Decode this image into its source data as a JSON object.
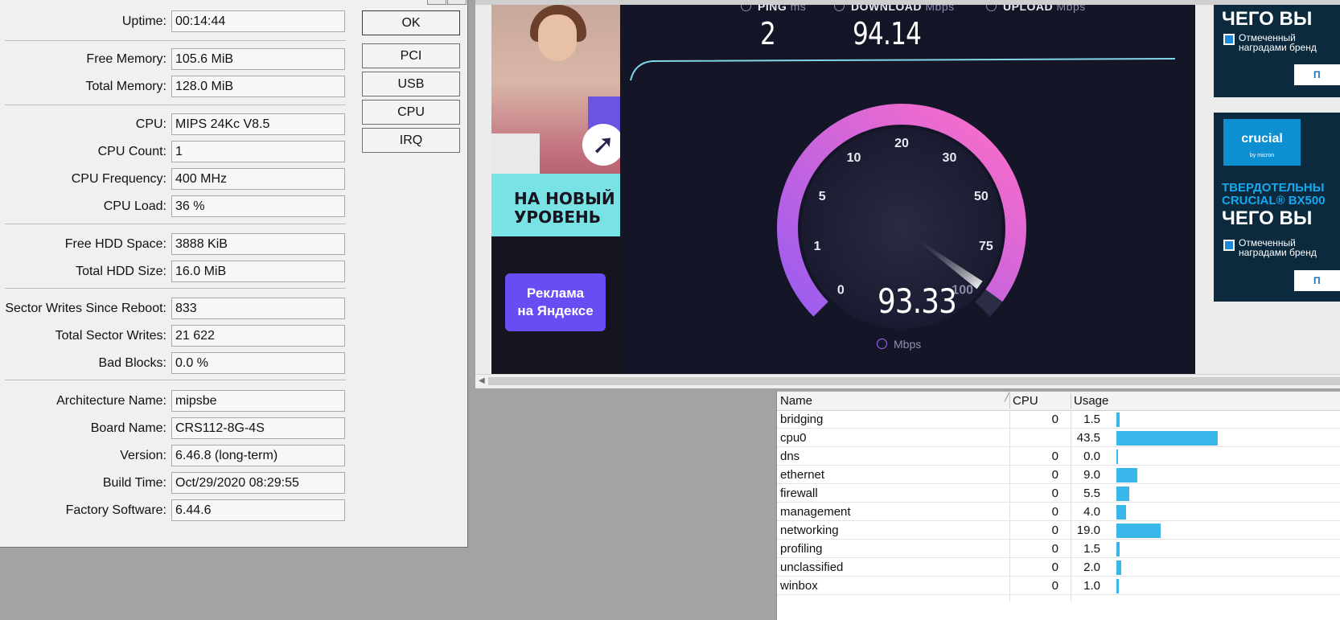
{
  "resources": {
    "rows": [
      {
        "label": "Uptime:",
        "value": "00:14:44"
      },
      {
        "label": "Free Memory:",
        "value": "105.6 MiB"
      },
      {
        "label": "Total Memory:",
        "value": "128.0 MiB"
      },
      {
        "label": "CPU:",
        "value": "MIPS 24Kc V8.5"
      },
      {
        "label": "CPU Count:",
        "value": "1"
      },
      {
        "label": "CPU Frequency:",
        "value": "400 MHz"
      },
      {
        "label": "CPU Load:",
        "value": "36 %"
      },
      {
        "label": "Free HDD Space:",
        "value": "3888 KiB"
      },
      {
        "label": "Total HDD Size:",
        "value": "16.0 MiB"
      },
      {
        "label": "Sector Writes Since Reboot:",
        "value": "833"
      },
      {
        "label": "Total Sector Writes:",
        "value": "21 622"
      },
      {
        "label": "Bad Blocks:",
        "value": "0.0 %"
      },
      {
        "label": "Architecture Name:",
        "value": "mipsbe"
      },
      {
        "label": "Board Name:",
        "value": "CRS112-8G-4S"
      },
      {
        "label": "Version:",
        "value": "6.46.8 (long-term)"
      },
      {
        "label": "Build Time:",
        "value": "Oct/29/2020 08:29:55"
      },
      {
        "label": "Factory Software:",
        "value": "6.44.6"
      }
    ],
    "buttons": {
      "ok": "OK",
      "pci": "PCI",
      "usb": "USB",
      "cpu": "CPU",
      "irq": "IRQ"
    }
  },
  "speedtest": {
    "ping": {
      "label": "PING",
      "unit": "ms",
      "value": "2"
    },
    "download": {
      "label": "DOWNLOAD",
      "unit": "Mbps",
      "value": "94.14"
    },
    "upload": {
      "label": "UPLOAD",
      "unit": "Mbps"
    },
    "current_speed": "93.33",
    "current_unit": "Mbps",
    "gauge_ticks": [
      "0",
      "1",
      "5",
      "10",
      "20",
      "30",
      "50",
      "75",
      "100"
    ],
    "gauge_value_mbps": 93.33
  },
  "ads": {
    "left_headline_line1": "НА НОВЫЙ",
    "left_headline_line2": "УРОВЕНЬ",
    "left_cta_line1": "Реклама",
    "left_cta_line2": "на Яндексе",
    "right_headline": "ЧЕГО ВЫ",
    "right_note_line1": "Отмеченный",
    "right_note_line2": "наградами бренд",
    "right_button": "П",
    "right_logo": "crucial",
    "right_logo_sub": "by micron",
    "right_blue_line1": "ТВЕРДОТЕЛЬНЫ",
    "right_blue_line2": "CRUCIAL® BX500",
    "right_headline2": "ЧЕГО ВЫ"
  },
  "profile": {
    "columns": {
      "name": "Name",
      "cpu": "CPU",
      "usage": "Usage"
    },
    "rows": [
      {
        "name": "bridging",
        "cpu": "0",
        "usage": "1.5",
        "pct": 1.5
      },
      {
        "name": "cpu0",
        "cpu": "",
        "usage": "43.5",
        "pct": 43.5
      },
      {
        "name": "dns",
        "cpu": "0",
        "usage": "0.0",
        "pct": 0.0
      },
      {
        "name": "ethernet",
        "cpu": "0",
        "usage": "9.0",
        "pct": 9.0
      },
      {
        "name": "firewall",
        "cpu": "0",
        "usage": "5.5",
        "pct": 5.5
      },
      {
        "name": "management",
        "cpu": "0",
        "usage": "4.0",
        "pct": 4.0
      },
      {
        "name": "networking",
        "cpu": "0",
        "usage": "19.0",
        "pct": 19.0
      },
      {
        "name": "profiling",
        "cpu": "0",
        "usage": "1.5",
        "pct": 1.5
      },
      {
        "name": "unclassified",
        "cpu": "0",
        "usage": "2.0",
        "pct": 2.0
      },
      {
        "name": "winbox",
        "cpu": "0",
        "usage": "1.0",
        "pct": 1.0
      }
    ]
  },
  "colors": {
    "gauge_start": "#9a5cf0",
    "gauge_end": "#ff6ec7",
    "usage_bar": "#3ab7ea",
    "speed_bg": "#141527"
  }
}
